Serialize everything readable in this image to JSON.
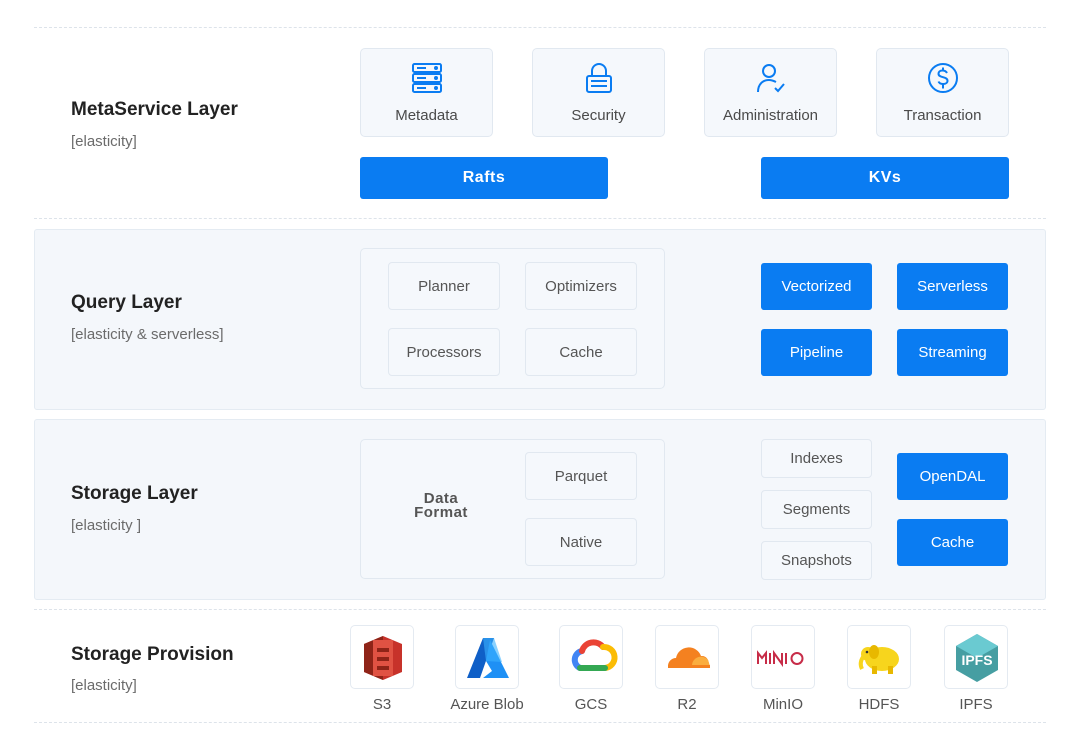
{
  "meta": {
    "title": "MetaService Layer",
    "subtitle": "[elasticity]",
    "cards": [
      {
        "label": "Metadata",
        "icon": "server-stack-icon"
      },
      {
        "label": "Security",
        "icon": "lock-icon"
      },
      {
        "label": "Administration",
        "icon": "user-check-icon"
      },
      {
        "label": "Transaction",
        "icon": "dollar-circle-icon"
      }
    ],
    "bars": [
      "Rafts",
      "KVs"
    ]
  },
  "query": {
    "title": "Query Layer",
    "subtitle": "[elasticity & serverless]",
    "chips": [
      "Planner",
      "Optimizers",
      "Processors",
      "Cache"
    ],
    "features": [
      "Vectorized",
      "Serverless",
      "Pipeline",
      "Streaming"
    ]
  },
  "storage": {
    "title": "Storage Layer",
    "subtitle": "[elasticity ]",
    "data_format_line1": "Data",
    "data_format_line2": "Format",
    "formats": [
      "Parquet",
      "Native"
    ],
    "structures": [
      "Indexes",
      "Segments",
      "Snapshots"
    ],
    "features": [
      "OpenDAL",
      "Cache"
    ]
  },
  "provision": {
    "title": "Storage Provision",
    "subtitle": "[elasticity]",
    "providers": [
      {
        "label": "S3",
        "icon": "aws-s3-icon"
      },
      {
        "label": "Azure Blob",
        "icon": "azure-icon"
      },
      {
        "label": "GCS",
        "icon": "google-cloud-icon"
      },
      {
        "label": "R2",
        "icon": "cloudflare-icon"
      },
      {
        "label": "MinIO",
        "icon": "minio-icon"
      },
      {
        "label": "HDFS",
        "icon": "hadoop-elephant-icon"
      },
      {
        "label": "IPFS",
        "icon": "ipfs-icon"
      }
    ]
  },
  "colors": {
    "accent": "#0a7cf2",
    "panel": "#f4f7fb",
    "border": "#e1e8f0"
  }
}
